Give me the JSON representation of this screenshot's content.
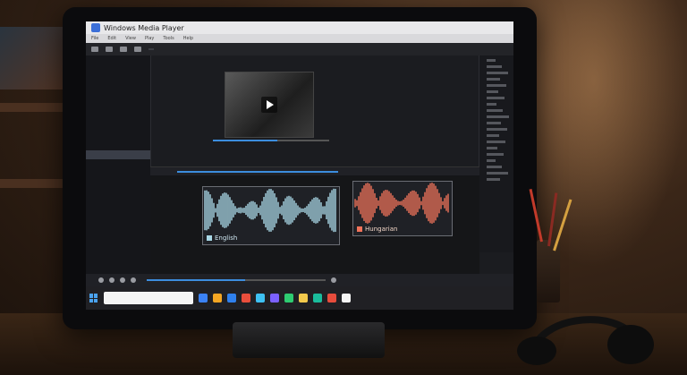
{
  "window": {
    "title": "Windows Media Player"
  },
  "menu": [
    "File",
    "Edit",
    "View",
    "Play",
    "Tools",
    "Help",
    "",
    "",
    "",
    ""
  ],
  "toolbar": {
    "tab_label": ""
  },
  "sidebar": {
    "header": "",
    "items": [
      "",
      "",
      "",
      "",
      "",
      "",
      "",
      "",
      "",
      "",
      "",
      "",
      "",
      "",
      "",
      "",
      "",
      ""
    ],
    "selected_index": 10
  },
  "video": {
    "progress": 0.55
  },
  "timeline": {
    "progress": 0.6
  },
  "tracks": [
    {
      "label": "English",
      "color": "#a9d8e6"
    },
    {
      "label": "Hungarian",
      "color": "#f0735a"
    }
  ],
  "playback": {
    "progress": 0.55
  },
  "taskbar": {
    "search_placeholder": "",
    "icon_colors": [
      "#3b82f6",
      "#f5a623",
      "#2f80ed",
      "#e94e3c",
      "#3ec1f3",
      "#7b61ff",
      "#2ecc71",
      "#f2c94c",
      "#1abc9c",
      "#e74c3c",
      "#f5f5f5"
    ]
  },
  "colors": {
    "accent": "#3c8dde"
  }
}
